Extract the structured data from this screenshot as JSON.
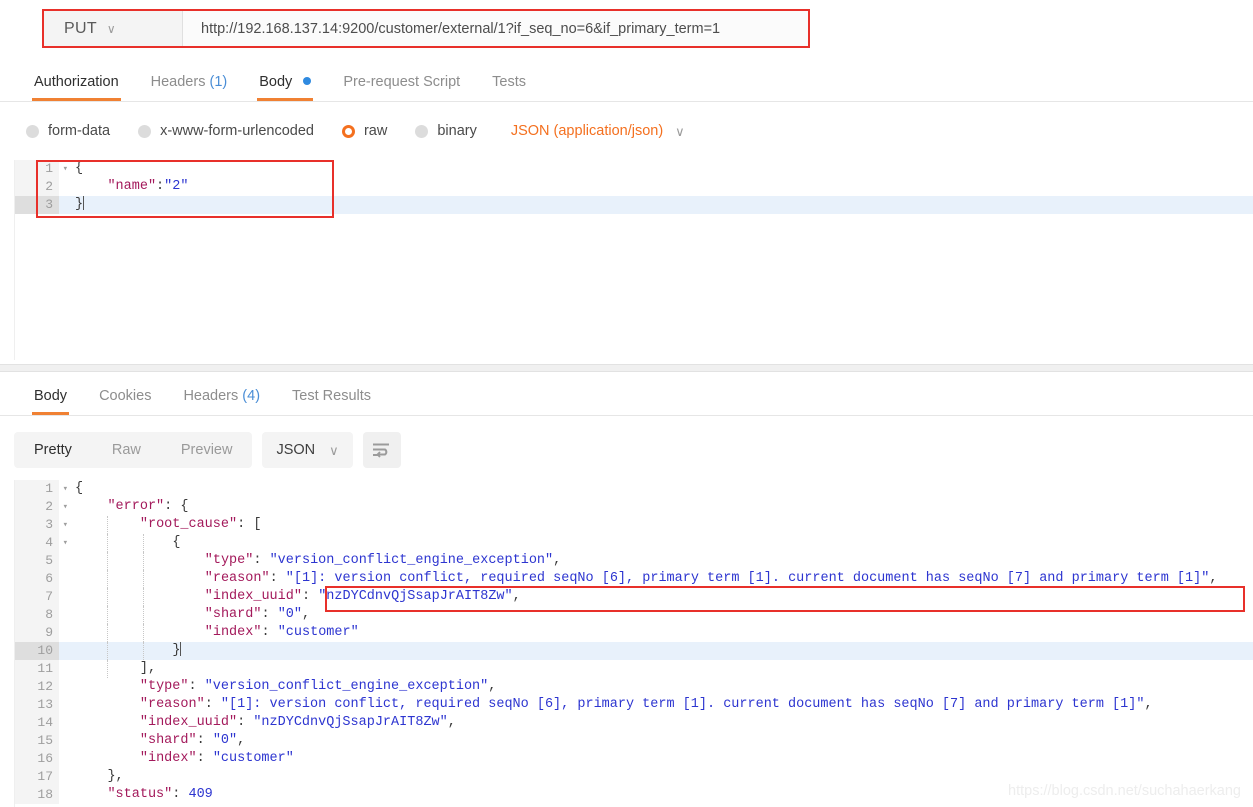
{
  "request": {
    "method": "PUT",
    "method_caret": "∨",
    "url": "http://192.168.137.14:9200/customer/external/1?if_seq_no=6&if_primary_term=1",
    "tabs": [
      {
        "label": "Authorization",
        "active": false,
        "count": "",
        "dot": false
      },
      {
        "label": "Headers",
        "active": false,
        "count": "(1)",
        "dot": false
      },
      {
        "label": "Body",
        "active": true,
        "count": "",
        "dot": true
      },
      {
        "label": "Pre-request Script",
        "active": false,
        "count": "",
        "dot": false
      },
      {
        "label": "Tests",
        "active": false,
        "count": "",
        "dot": false
      }
    ],
    "body_types": [
      {
        "label": "form-data",
        "selected": false
      },
      {
        "label": "x-www-form-urlencoded",
        "selected": false
      },
      {
        "label": "raw",
        "selected": true
      },
      {
        "label": "binary",
        "selected": false
      }
    ],
    "content_type": "JSON (application/json)",
    "content_type_caret": "∨",
    "body_lines": [
      {
        "num": "1",
        "fold": "▾",
        "text": "{",
        "highlight": false
      },
      {
        "num": "2",
        "fold": "",
        "text": "    \"name\":\"2\"",
        "highlight": false
      },
      {
        "num": "3",
        "fold": "",
        "text": "}",
        "highlight": true
      }
    ],
    "body_raw": "{\n    \"name\":\"2\"\n}"
  },
  "response": {
    "tabs": [
      {
        "label": "Body",
        "active": true,
        "count": ""
      },
      {
        "label": "Cookies",
        "active": false,
        "count": ""
      },
      {
        "label": "Headers",
        "active": false,
        "count": "(4)"
      },
      {
        "label": "Test Results",
        "active": false,
        "count": ""
      }
    ],
    "view_modes": [
      {
        "label": "Pretty",
        "active": true
      },
      {
        "label": "Raw",
        "active": false
      },
      {
        "label": "Preview",
        "active": false
      }
    ],
    "format": "JSON",
    "format_caret": "∨",
    "wrap_icon": "word-wrap-icon",
    "body_lines": [
      {
        "num": "1",
        "fold": "▾",
        "text": "{",
        "highlight": false
      },
      {
        "num": "2",
        "fold": "▾",
        "text": "    \"error\": {",
        "highlight": false
      },
      {
        "num": "3",
        "fold": "▾",
        "text": "        \"root_cause\": [",
        "highlight": false
      },
      {
        "num": "4",
        "fold": "▾",
        "text": "            {",
        "highlight": false
      },
      {
        "num": "5",
        "fold": "",
        "text": "                \"type\": \"version_conflict_engine_exception\",",
        "highlight": false
      },
      {
        "num": "6",
        "fold": "",
        "text": "                \"reason\": \"[1]: version conflict, required seqNo [6], primary term [1]. current document has seqNo [7] and primary term [1]\",",
        "highlight": false
      },
      {
        "num": "7",
        "fold": "",
        "text": "                \"index_uuid\": \"nzDYCdnvQjSsapJrAIT8Zw\",",
        "highlight": false
      },
      {
        "num": "8",
        "fold": "",
        "text": "                \"shard\": \"0\",",
        "highlight": false
      },
      {
        "num": "9",
        "fold": "",
        "text": "                \"index\": \"customer\"",
        "highlight": false
      },
      {
        "num": "10",
        "fold": "",
        "text": "            }",
        "highlight": true
      },
      {
        "num": "11",
        "fold": "",
        "text": "        ],",
        "highlight": false
      },
      {
        "num": "12",
        "fold": "",
        "text": "        \"type\": \"version_conflict_engine_exception\",",
        "highlight": false
      },
      {
        "num": "13",
        "fold": "",
        "text": "        \"reason\": \"[1]: version conflict, required seqNo [6], primary term [1]. current document has seqNo [7] and primary term [1]\",",
        "highlight": false
      },
      {
        "num": "14",
        "fold": "",
        "text": "        \"index_uuid\": \"nzDYCdnvQjSsapJrAIT8Zw\",",
        "highlight": false
      },
      {
        "num": "15",
        "fold": "",
        "text": "        \"shard\": \"0\",",
        "highlight": false
      },
      {
        "num": "16",
        "fold": "",
        "text": "        \"index\": \"customer\"",
        "highlight": false
      },
      {
        "num": "17",
        "fold": "",
        "text": "    },",
        "highlight": false
      },
      {
        "num": "18",
        "fold": "",
        "text": "    \"status\": 409",
        "highlight": false
      }
    ],
    "error": {
      "type": "version_conflict_engine_exception",
      "reason": "[1]: version conflict, required seqNo [6], primary term [1]. current document has seqNo [7] and primary term [1]",
      "index_uuid": "nzDYCdnvQjSsapJrAIT8Zw",
      "shard": "0",
      "index": "customer",
      "status": 409
    }
  },
  "annotations": {
    "url_highlight_color": "#e8302a",
    "request_body_highlight_color": "#e8302a",
    "response_reason_highlight_color": "#e8302a"
  },
  "watermark": "https://blog.csdn.net/suchahaerkang"
}
